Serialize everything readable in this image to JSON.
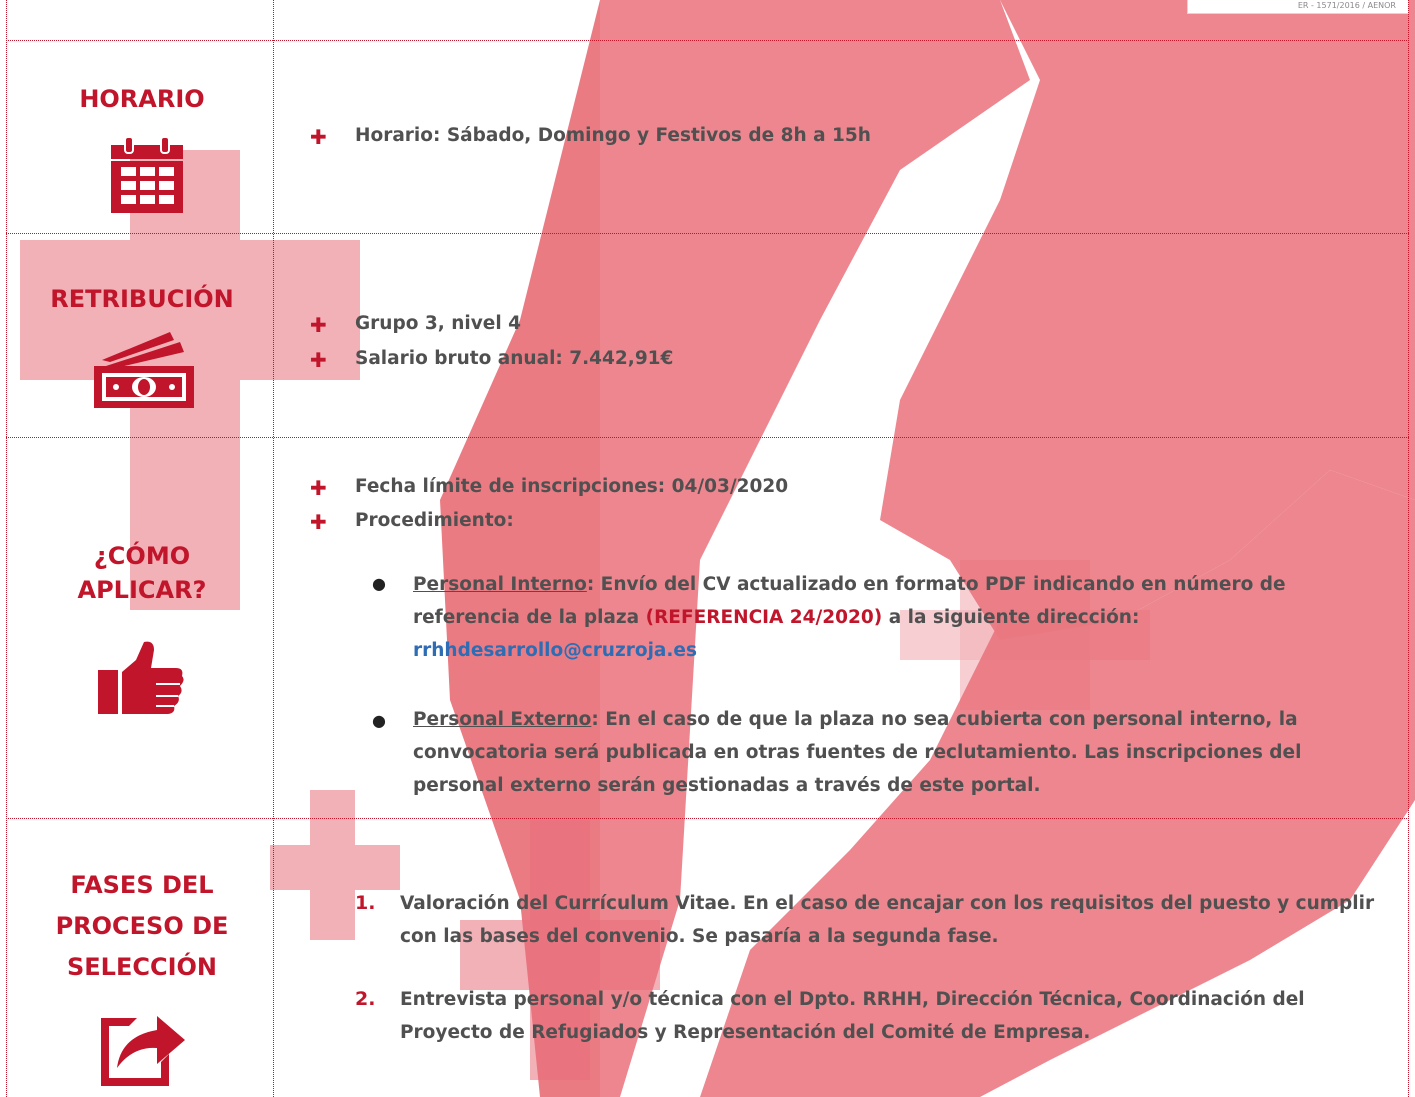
{
  "colors": {
    "accent": "#c0152a",
    "text": "#505050",
    "link": "#2e6db4"
  },
  "corner_stamp": "ER - 1571/2016 / AENOR",
  "sections": {
    "horario": {
      "title": "HORARIO",
      "icon": "calendar-icon",
      "bullets": [
        "Horario: Sábado, Domingo y Festivos de 8h a 15h"
      ]
    },
    "retribucion": {
      "title": "RETRIBUCIÓN",
      "icon": "money-icon",
      "bullets": [
        "Grupo 3, nivel 4",
        "Salario bruto anual: 7.442,91€"
      ]
    },
    "aplicar": {
      "title_line1": "¿CÓMO",
      "title_line2": "APLICAR?",
      "icon": "thumbs-up-icon",
      "bullets": [
        "Fecha límite de inscripciones: 04/03/2020",
        "Procedimiento:"
      ],
      "interno": {
        "label": "Personal Interno",
        "text1": ": Envío del CV actualizado en formato PDF indicando en número de referencia de la plaza ",
        "ref": "(REFERENCIA 24/2020)",
        "text2": " a la siguiente dirección:",
        "email": "rrhhdesarrollo@cruzroja.es"
      },
      "externo": {
        "label": "Personal Externo",
        "text": ": En el caso de que la plaza no sea cubierta con personal interno, la convocatoria será publicada en otras fuentes de reclutamiento. Las inscripciones del personal externo serán gestionadas a través de este portal."
      }
    },
    "fases": {
      "title_line1": "FASES DEL",
      "title_line2": "PROCESO DE",
      "title_line3": "SELECCIÓN",
      "icon": "share-arrow-icon",
      "items": [
        {
          "num": "1.",
          "text": "Valoración del Currículum Vitae. En el caso de encajar con los requisitos del puesto y cumplir con las bases del convenio. Se pasaría a la segunda fase."
        },
        {
          "num": "2.",
          "text": "Entrevista personal y/o técnica con el Dpto. RRHH, Dirección Técnica, Coordinación del Proyecto de Refugiados y Representación del Comité de Empresa."
        }
      ]
    }
  }
}
